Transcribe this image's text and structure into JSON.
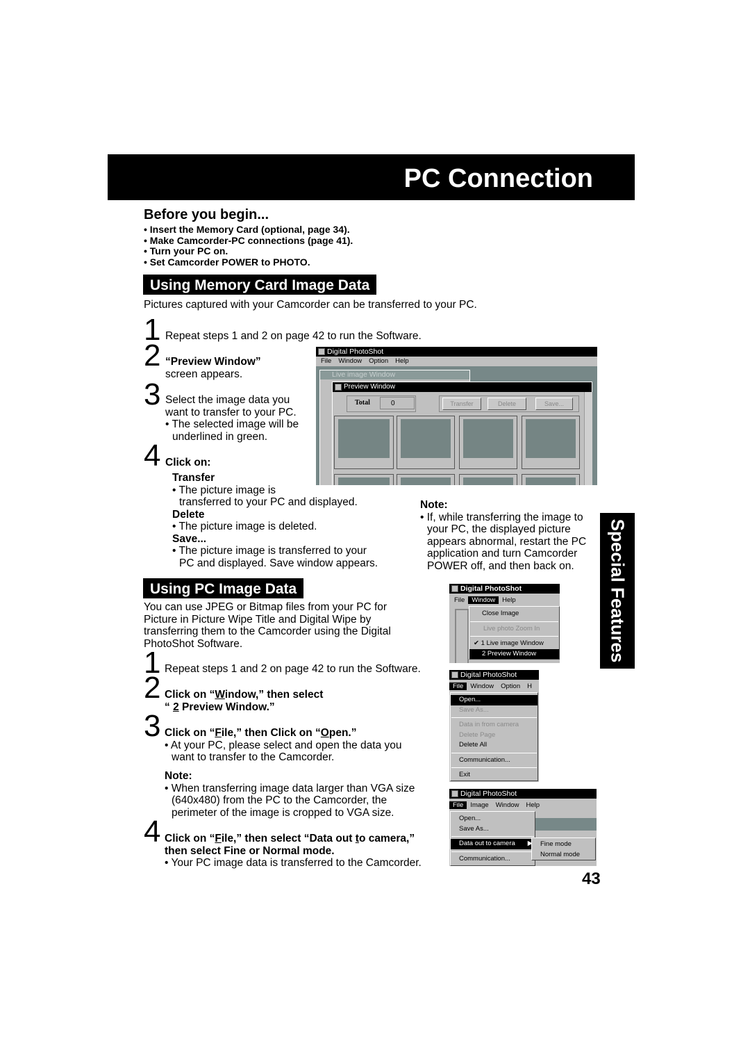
{
  "header": {
    "title": "PC Connection"
  },
  "before": {
    "title": "Before you begin...",
    "items": [
      "Insert the Memory Card (optional, page 34).",
      "Make Camcorder-PC connections (page 41).",
      "Turn your PC on.",
      "Set Camcorder POWER to PHOTO."
    ]
  },
  "memory": {
    "title": "Using Memory Card Image Data",
    "intro": "Pictures captured with your Camcorder can be transferred to your PC.",
    "step1": {
      "num": "1",
      "text": "Repeat steps 1 and 2 on page 42 to run the Software."
    },
    "step2": {
      "num": "2",
      "title": "“Preview Window”",
      "text": "screen appears."
    },
    "step3": {
      "num": "3",
      "text1": "Select the image data you",
      "text2": "want to transfer to your PC.",
      "bullet1": "• The selected image will be",
      "bullet2": "underlined in green."
    },
    "step4": {
      "num": "4",
      "title": "Click on:",
      "transfer": "Transfer",
      "transfer_b1": "• The picture image is",
      "transfer_b2": "transferred to your PC and displayed.",
      "delete": "Delete",
      "delete_b": "• The picture image is deleted.",
      "save": "Save...",
      "save_b1": "• The picture image is transferred to your",
      "save_b2": "PC and displayed. Save window appears."
    },
    "note": {
      "title": "Note:",
      "lines": [
        "• If, while transferring the image to",
        "your PC, the displayed picture",
        "appears abnormal, restart the PC",
        "application and turn Camcorder",
        "POWER off, and then back on."
      ]
    }
  },
  "pc": {
    "title": "Using PC Image Data",
    "intro": [
      "You can use JPEG or Bitmap files from your PC for",
      "Picture in Picture Wipe Title and Digital Wipe by",
      "transferring them to the Camcorder using the Digital",
      "PhotoShot Software."
    ],
    "step1": {
      "num": "1",
      "text": "Repeat steps 1 and 2 on page 42 to run the Software."
    },
    "step2": {
      "num": "2",
      "a": "Click on “",
      "w": "W",
      "b": "indow,” then select",
      "c": "“ ",
      "n": "2",
      "d": " Preview Window.”"
    },
    "step3": {
      "num": "3",
      "a": "Click on “",
      "f": "F",
      "b": "ile,” then Click on “",
      "o": "O",
      "c": "pen.”",
      "b1": "• At your PC, please select and open the data you",
      "b2": "want to transfer to the Camcorder."
    },
    "note": {
      "title": "Note:",
      "lines": [
        "• When transferring image data larger than VGA size",
        "(640x480) from the PC to the Camcorder, the",
        "perimeter of the image is cropped to VGA size."
      ]
    },
    "step4": {
      "num": "4",
      "a": "Click on “",
      "f": "F",
      "b": "ile,” then select “Data out ",
      "t": "t",
      "c": "o camera,”",
      "line2": "then select Fine or Normal mode.",
      "b1": "• Your PC image data is transferred to the Camcorder."
    }
  },
  "app": {
    "title": "Digital PhotoShot",
    "menu1": [
      "File",
      "Window",
      "Option",
      "Help"
    ],
    "live": "Live image Window",
    "preview": "Preview Window",
    "total_label": "Total",
    "total_value": "0",
    "buttons": [
      "Transfer",
      "Delete",
      "Save..."
    ],
    "menu2": [
      "File",
      "Window",
      "Help"
    ],
    "window_menu": [
      "Close Image",
      "Live photo Zoom In",
      "1 Live image Window",
      "2 Preview Window"
    ],
    "menu3": [
      "File",
      "Window",
      "Option",
      "H"
    ],
    "file_menu": [
      "Open...",
      "Save As...",
      "Data in from camera",
      "Delete Page",
      "Delete All",
      "Communication...",
      "Exit"
    ],
    "menu4": [
      "File",
      "Image",
      "Window",
      "Help"
    ],
    "file_menu2": [
      "Open...",
      "Save As...",
      "Data out to camera",
      "Communication..."
    ],
    "sub": [
      "Fine mode",
      "Normal mode"
    ]
  },
  "side_tab": "Special Features",
  "page_number": "43"
}
